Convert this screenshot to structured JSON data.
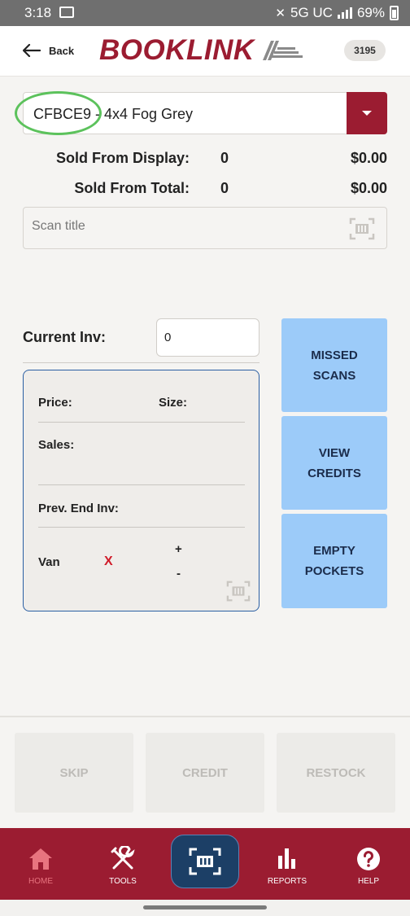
{
  "status_bar": {
    "time": "3:18",
    "network": "5G UC",
    "battery": "69%"
  },
  "header": {
    "back_label": "Back",
    "logo_text": "BOOKLINK",
    "store_number": "3195"
  },
  "product_select": {
    "value": "CFBCE9 - 4x4 Fog Grey"
  },
  "sold_from_display": {
    "label": "Sold From Display:",
    "count": "0",
    "amount": "$0.00"
  },
  "sold_from_total": {
    "label": "Sold From Total:",
    "count": "0",
    "amount": "$0.00"
  },
  "scan_title": {
    "placeholder": "Scan title"
  },
  "current_inv": {
    "label": "Current Inv:",
    "value": "0"
  },
  "details_card": {
    "price_label": "Price:",
    "size_label": "Size:",
    "sales_label": "Sales:",
    "prev_end_inv_label": "Prev. End Inv:",
    "van_label": "Van",
    "van_status": "X",
    "plus": "+",
    "minus": "-"
  },
  "side_buttons": {
    "missed_scans": "MISSED SCANS",
    "view_credits": "VIEW CREDITS",
    "empty_pockets": "EMPTY POCKETS"
  },
  "actions": {
    "skip": "SKIP",
    "credit": "CREDIT",
    "restock": "RESTOCK"
  },
  "bottom_nav": {
    "home": "HOME",
    "tools": "TOOLS",
    "reports": "REPORTS",
    "help": "HELP"
  },
  "colors": {
    "brand_red": "#9b1c31",
    "side_button_blue": "#9ccbf9",
    "scan_fab_navy": "#1c3f66",
    "card_border": "#2b5fa3",
    "highlight_ring": "#5cc25c",
    "van_x_red": "#d01c2a"
  },
  "icons": [
    "back-arrow-icon",
    "dropdown-caret-icon",
    "barcode-scan-icon",
    "home-icon",
    "tools-icon",
    "reports-icon",
    "help-icon"
  ]
}
